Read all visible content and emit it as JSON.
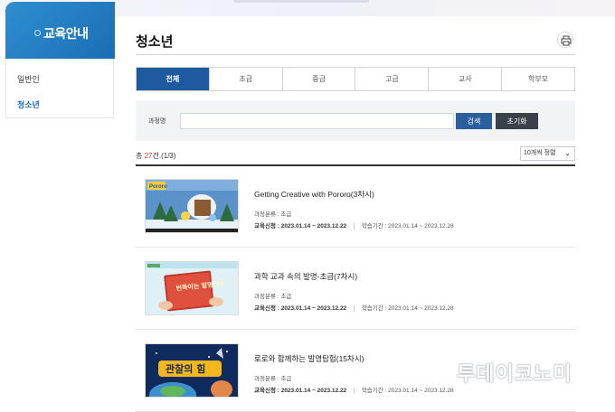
{
  "sidebar": {
    "title": "교육안내",
    "items": [
      {
        "label": "일반인",
        "active": false
      },
      {
        "label": "청소년",
        "active": true
      }
    ]
  },
  "page": {
    "title": "청소년",
    "print_icon": "print-icon"
  },
  "tabs": [
    {
      "label": "전체",
      "active": true
    },
    {
      "label": "초급"
    },
    {
      "label": "중급"
    },
    {
      "label": "고급"
    },
    {
      "label": "교사"
    },
    {
      "label": "학부모"
    }
  ],
  "search": {
    "label": "과정명",
    "value": "",
    "search_label": "검색",
    "reset_label": "초기화"
  },
  "list": {
    "count_prefix": "총",
    "count": "27",
    "count_suffix": "건.(1/3)",
    "sort_value": "10개씩 정렬",
    "items": [
      {
        "title": "Getting Creative with Pororo(3차시)",
        "category": "과정분류 : 초급",
        "apply_label": "교육신청 : ",
        "apply": "2023.01.14 ~ 2023.12.22",
        "study_label": "학습기간 : ",
        "study": "2023.01.14 ~ 2023.12.28",
        "thumb_text": "Pororo"
      },
      {
        "title": "과학 교과 속의 발명-초급(7차시)",
        "category": "과정분류 : 초급",
        "apply_label": "교육신청 : ",
        "apply": "2023.01.14 ~ 2023.12.22",
        "study_label": "학습기간 : ",
        "study": "2023.01.14 ~ 2023.12.28",
        "thumb_text": "번뜩이는 발명가들"
      },
      {
        "title": "로로와 함께하는 발명탐험(15차시)",
        "category": "과정분류 : 초급",
        "apply_label": "교육신청 : ",
        "apply": "2023.01.14 ~ 2023.12.22",
        "study_label": "학습기간 : ",
        "study": "2023.01.14 ~ 2023.12.28",
        "thumb_text": "관찰의 힘"
      }
    ]
  },
  "watermark": "투데이코노미",
  "colors": {
    "primary": "#1f5aa0",
    "sidebar_head": "#2f8fd0",
    "reset_button": "#3b4149",
    "count_highlight": "#dd3333"
  }
}
